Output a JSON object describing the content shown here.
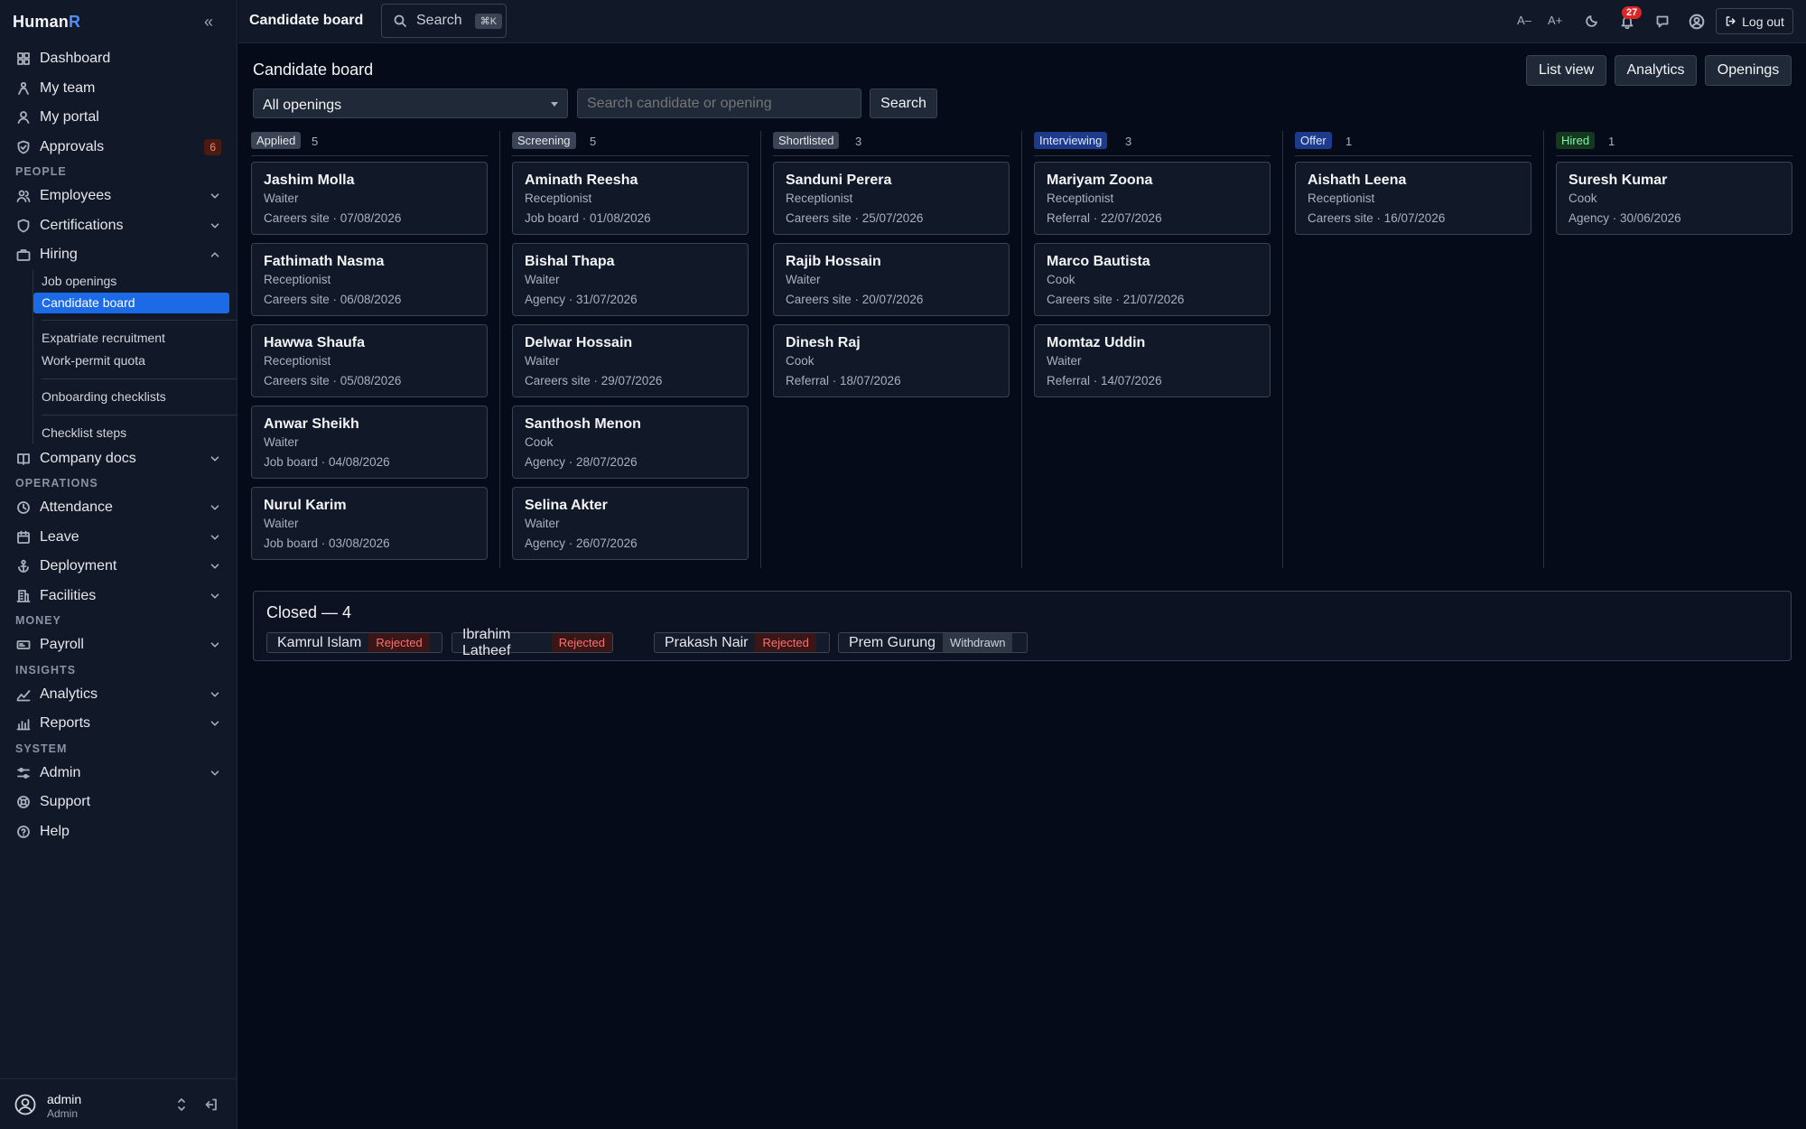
{
  "app": {
    "brand_main": "Human",
    "brand_accent": "R"
  },
  "sidebar": {
    "items_top": [
      {
        "label": "Dashboard",
        "icon": "grid-icon"
      },
      {
        "label": "My team",
        "icon": "team-icon"
      },
      {
        "label": "My portal",
        "icon": "user-icon"
      },
      {
        "label": "Approvals",
        "icon": "shield-icon",
        "badge": "6"
      }
    ],
    "sections": {
      "people": "PEOPLE",
      "operations": "OPERATIONS",
      "money": "MONEY",
      "insights": "INSIGHTS",
      "system": "SYSTEM"
    },
    "people_items": {
      "employees": "Employees",
      "certifications": "Certifications",
      "hiring": "Hiring",
      "company_docs": "Company docs"
    },
    "hiring_sub": [
      "Job openings",
      "Candidate board",
      "Expatriate recruitment",
      "Work-permit quota",
      "Onboarding checklists",
      "Checklist steps"
    ],
    "operations_items": {
      "attendance": "Attendance",
      "leave": "Leave",
      "deployment": "Deployment",
      "facilities": "Facilities"
    },
    "money_items": {
      "payroll": "Payroll"
    },
    "insights_items": {
      "analytics": "Analytics",
      "reports": "Reports"
    },
    "system_items": {
      "admin": "Admin",
      "support": "Support",
      "help": "Help"
    },
    "user": {
      "name": "admin",
      "role": "Admin"
    }
  },
  "topbar": {
    "title": "Candidate board",
    "search_label": "Search",
    "search_shortcut": "⌘K",
    "font_smaller": "A–",
    "font_larger": "A+",
    "notifications_count": "27",
    "logout": "Log out"
  },
  "main": {
    "title": "Candidate board",
    "buttons": {
      "list_view": "List view",
      "analytics": "Analytics",
      "openings": "Openings"
    },
    "filter_select": "All openings",
    "search_placeholder": "Search candidate or opening",
    "search_button": "Search"
  },
  "board": {
    "columns": [
      {
        "stage": "Applied",
        "count": "5",
        "tag_bg": "#3b4454",
        "tag_fg": "#e5e7eb",
        "cards": [
          {
            "name": "Jashim Molla",
            "role": "Waiter",
            "source": "Careers site · 07/08/2026"
          },
          {
            "name": "Fathimath Nasma",
            "role": "Receptionist",
            "source": "Careers site · 06/08/2026"
          },
          {
            "name": "Hawwa Shaufa",
            "role": "Receptionist",
            "source": "Careers site · 05/08/2026"
          },
          {
            "name": "Anwar Sheikh",
            "role": "Waiter",
            "source": "Job board · 04/08/2026"
          },
          {
            "name": "Nurul Karim",
            "role": "Waiter",
            "source": "Job board · 03/08/2026"
          }
        ]
      },
      {
        "stage": "Screening",
        "count": "5",
        "tag_bg": "#3b4454",
        "tag_fg": "#e5e7eb",
        "cards": [
          {
            "name": "Aminath Reesha",
            "role": "Receptionist",
            "source": "Job board · 01/08/2026"
          },
          {
            "name": "Bishal Thapa",
            "role": "Waiter",
            "source": "Agency · 31/07/2026"
          },
          {
            "name": "Delwar Hossain",
            "role": "Waiter",
            "source": "Careers site · 29/07/2026"
          },
          {
            "name": "Santhosh Menon",
            "role": "Cook",
            "source": "Agency · 28/07/2026"
          },
          {
            "name": "Selina Akter",
            "role": "Waiter",
            "source": "Agency · 26/07/2026"
          }
        ]
      },
      {
        "stage": "Shortlisted",
        "count": "3",
        "tag_bg": "#3b4454",
        "tag_fg": "#e5e7eb",
        "cards": [
          {
            "name": "Sanduni Perera",
            "role": "Receptionist",
            "source": "Careers site · 25/07/2026"
          },
          {
            "name": "Rajib Hossain",
            "role": "Waiter",
            "source": "Careers site · 20/07/2026"
          },
          {
            "name": "Dinesh Raj",
            "role": "Cook",
            "source": "Referral · 18/07/2026"
          }
        ]
      },
      {
        "stage": "Interviewing",
        "count": "3",
        "tag_bg": "#1e3a8a",
        "tag_fg": "#dbeafe",
        "cards": [
          {
            "name": "Mariyam Zoona",
            "role": "Receptionist",
            "source": "Referral · 22/07/2026"
          },
          {
            "name": "Marco Bautista",
            "role": "Cook",
            "source": "Careers site · 21/07/2026"
          },
          {
            "name": "Momtaz Uddin",
            "role": "Waiter",
            "source": "Referral · 14/07/2026"
          }
        ]
      },
      {
        "stage": "Offer",
        "count": "1",
        "tag_bg": "#1e3a8a",
        "tag_fg": "#dbeafe",
        "cards": [
          {
            "name": "Aishath Leena",
            "role": "Receptionist",
            "source": "Careers site · 16/07/2026"
          }
        ]
      },
      {
        "stage": "Hired",
        "count": "1",
        "tag_bg": "#14391f",
        "tag_fg": "#86efac",
        "cards": [
          {
            "name": "Suresh Kumar",
            "role": "Cook",
            "source": "Agency · 30/06/2026"
          }
        ]
      }
    ],
    "closed": {
      "title": "Closed — 4",
      "items": [
        {
          "name": "Kamrul Islam",
          "status": "Rejected"
        },
        {
          "name": "Ibrahim Latheef",
          "status": "Rejected"
        },
        {
          "name": "Prakash Nair",
          "status": "Rejected"
        },
        {
          "name": "Prem Gurung",
          "status": "Withdrawn"
        }
      ]
    }
  }
}
